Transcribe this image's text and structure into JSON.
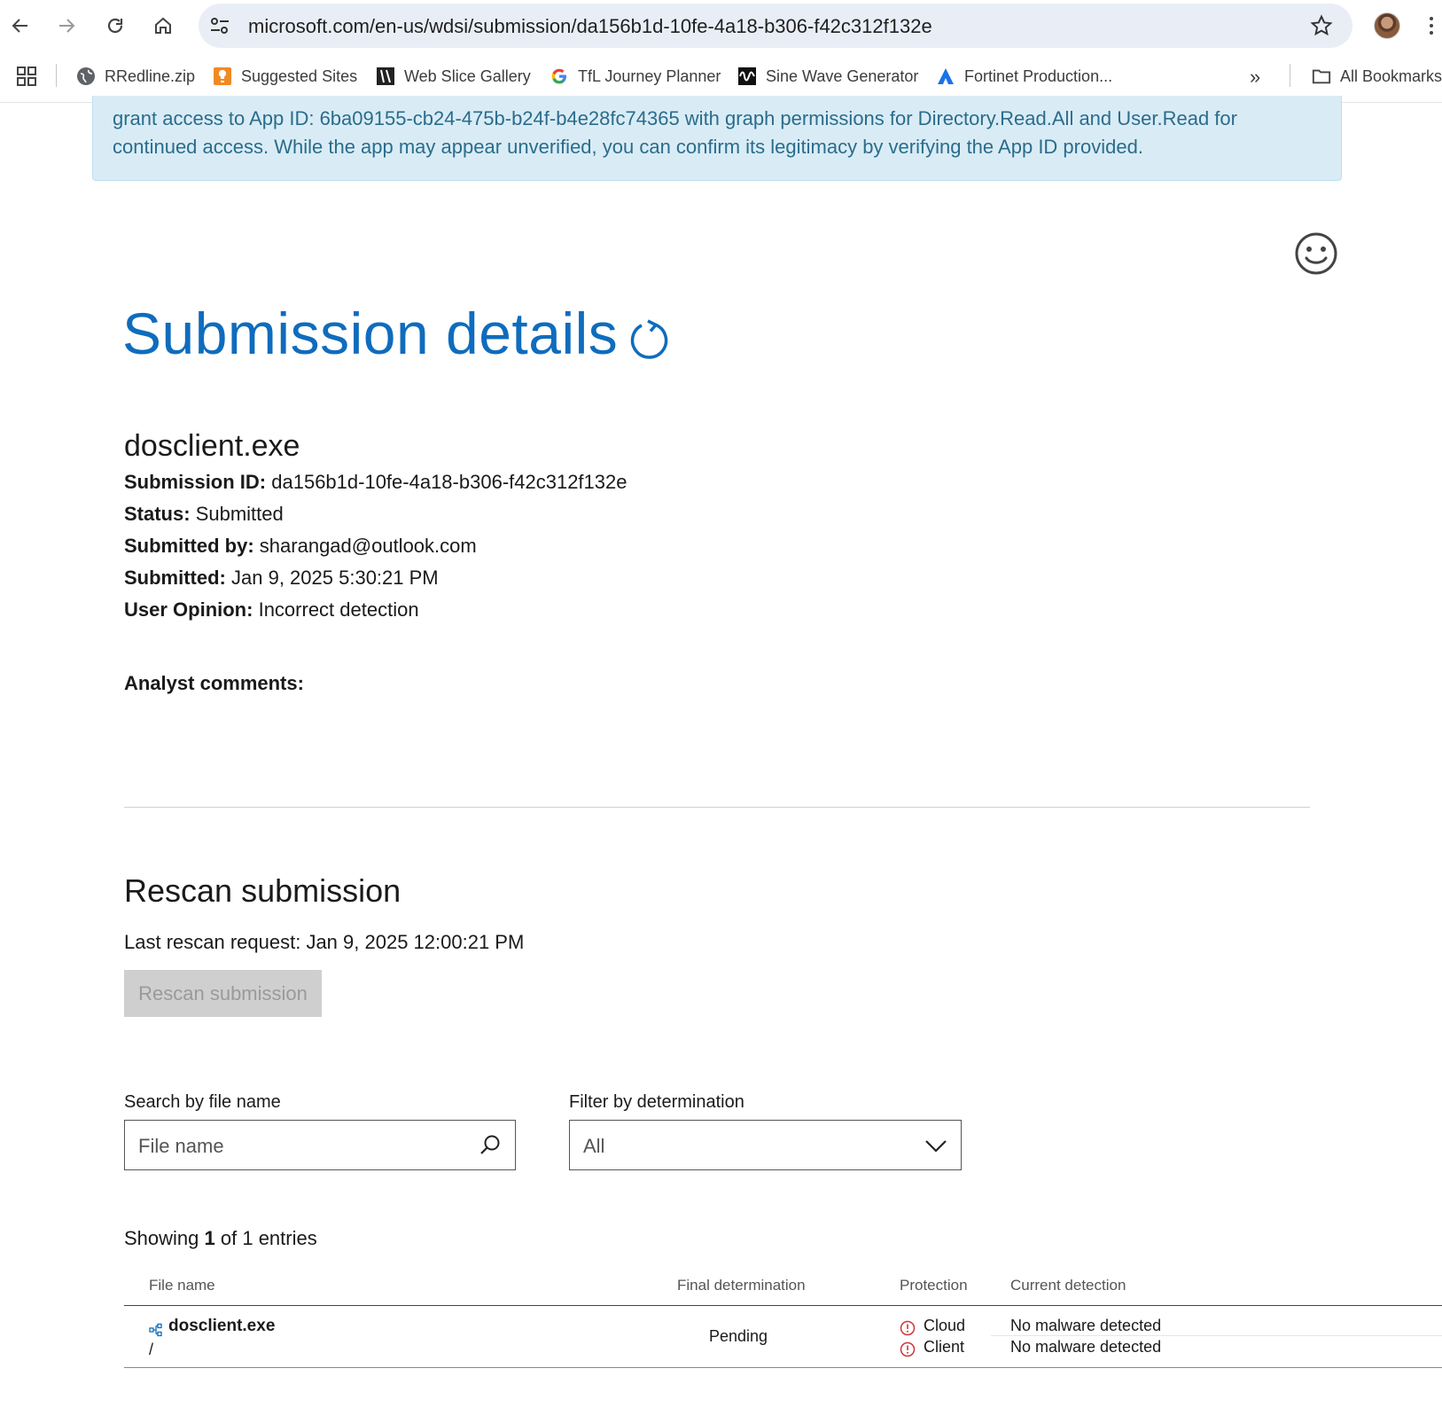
{
  "browser": {
    "url": "microsoft.com/en-us/wdsi/submission/da156b1d-10fe-4a18-b306-f42c312f132e",
    "bookmarks": [
      {
        "label": "RRedline.zip",
        "icon": "globe-icon"
      },
      {
        "label": "Suggested Sites",
        "icon": "suggested-sites-icon"
      },
      {
        "label": "Web Slice Gallery",
        "icon": "web-slice-icon"
      },
      {
        "label": "TfL Journey Planner",
        "icon": "google-g-icon"
      },
      {
        "label": "Sine Wave Generator",
        "icon": "sine-wave-icon"
      },
      {
        "label": "Fortinet Production...",
        "icon": "fortinet-icon"
      }
    ],
    "all_bookmarks_label": "All Bookmarks",
    "more_label": "»"
  },
  "alert": {
    "text": "grant access to App ID: 6ba09155-cb24-475b-b24f-b4e28fc74365 with graph permissions for Directory.Read.All and User.Read for continued access. While the app may appear unverified, you can confirm its legitimacy by verifying the App ID provided."
  },
  "page": {
    "title": "Submission details",
    "file_name": "dosclient.exe",
    "details": [
      {
        "label": "Submission ID:",
        "value": "da156b1d-10fe-4a18-b306-f42c312f132e"
      },
      {
        "label": "Status:",
        "value": "Submitted"
      },
      {
        "label": "Submitted by:",
        "value": "sharangad@outlook.com"
      },
      {
        "label": "Submitted:",
        "value": "Jan 9, 2025 5:30:21 PM"
      },
      {
        "label": "User Opinion:",
        "value": "Incorrect detection"
      }
    ],
    "analyst_comments_label": "Analyst comments:"
  },
  "rescan": {
    "title": "Rescan submission",
    "last_request": "Last rescan request: Jan 9, 2025 12:00:21 PM",
    "button_label": "Rescan submission"
  },
  "filters": {
    "search_label": "Search by file name",
    "search_placeholder": "File name",
    "filter_label": "Filter by determination",
    "filter_value": "All"
  },
  "results": {
    "showing_prefix": "Showing",
    "showing_count": "1",
    "showing_suffix": "of 1 entries",
    "columns": [
      "File name",
      "Final determination",
      "Protection",
      "Current detection"
    ],
    "rows": [
      {
        "file_name": "dosclient.exe",
        "path": "/",
        "final_determination": "Pending",
        "protection": [
          {
            "type": "Cloud",
            "detection": "No malware detected"
          },
          {
            "type": "Client",
            "detection": "No malware detected"
          }
        ]
      }
    ]
  },
  "colors": {
    "accent": "#0f6cbd",
    "alert_bg": "#d9ecf5",
    "alert_text": "#2b6c8c",
    "warning_red": "#d13438"
  }
}
